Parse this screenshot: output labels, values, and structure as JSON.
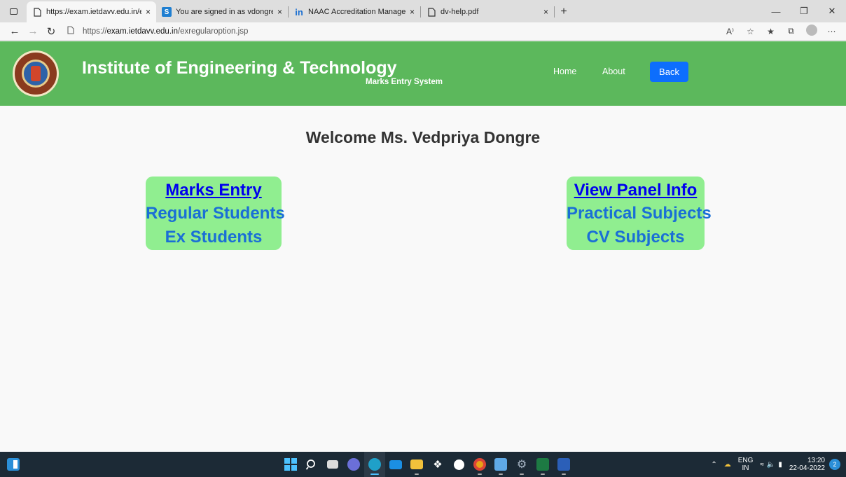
{
  "browser": {
    "tabs": [
      {
        "title": "https://exam.ietdavv.edu.in/exre",
        "icon": "page-icon",
        "close": "×"
      },
      {
        "title": "You are signed in as vdongre.iet",
        "icon": "s-icon",
        "icon_glyph": "S",
        "close": "×"
      },
      {
        "title": "NAAC Accreditation Manageme",
        "icon": "in-icon",
        "icon_glyph": "in",
        "close": "×"
      },
      {
        "title": "dv-help.pdf",
        "icon": "page-icon",
        "close": "×"
      }
    ],
    "new_tab": "+",
    "url_prefix": "https://",
    "url_host": "exam.ietdavv.edu.in",
    "url_path": "/exregularoption.jsp"
  },
  "site": {
    "title": "Institute of Engineering & Technology",
    "subtitle": "Marks Entry System",
    "nav": {
      "home": "Home",
      "about": "About",
      "back": "Back"
    }
  },
  "main": {
    "welcome": "Welcome Ms. Vedpriya Dongre",
    "cards": [
      {
        "heading": "Marks Entry",
        "items": [
          "Regular Students",
          "Ex Students"
        ]
      },
      {
        "heading": "View Panel Info",
        "items": [
          "Practical Subjects",
          "CV Subjects"
        ]
      }
    ]
  },
  "taskbar": {
    "lang_top": "ENG",
    "lang_bottom": "IN",
    "time": "13:20",
    "date": "22-04-2022",
    "notifications": "2"
  },
  "colors": {
    "header_green": "#5cb85c",
    "card_green": "#90ee90",
    "back_button": "#0d6efd",
    "taskbar": "#1c2a36"
  }
}
